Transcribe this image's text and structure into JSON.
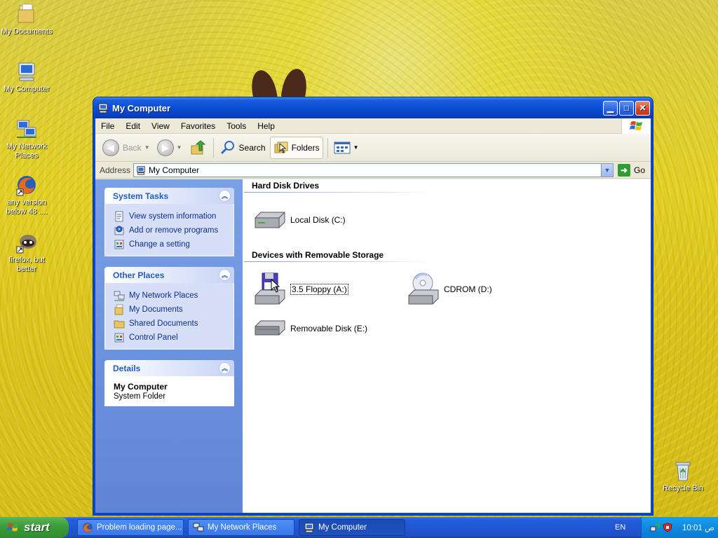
{
  "desktop": {
    "icons": [
      {
        "label": "My Documents"
      },
      {
        "label": "My Computer"
      },
      {
        "label": "My Network Places"
      },
      {
        "label": "any version below 48 ...."
      },
      {
        "label": "firefox, but better"
      },
      {
        "label": "Recycle Bin"
      }
    ]
  },
  "window": {
    "title": "My Computer",
    "menu": [
      "File",
      "Edit",
      "View",
      "Favorites",
      "Tools",
      "Help"
    ],
    "toolbar": {
      "back": "Back",
      "search": "Search",
      "folders": "Folders"
    },
    "address": {
      "label": "Address",
      "value": "My Computer",
      "go": "Go"
    },
    "taskpane": {
      "system_tasks": {
        "title": "System Tasks",
        "items": [
          "View system information",
          "Add or remove programs",
          "Change a setting"
        ]
      },
      "other_places": {
        "title": "Other Places",
        "items": [
          "My Network Places",
          "My Documents",
          "Shared Documents",
          "Control Panel"
        ]
      },
      "details": {
        "title": "Details",
        "name": "My Computer",
        "type": "System Folder"
      }
    },
    "groups": {
      "hard_disks": {
        "title": "Hard Disk Drives",
        "items": [
          "Local Disk (C:)"
        ]
      },
      "removable": {
        "title": "Devices with Removable Storage",
        "items": [
          "3.5 Floppy (A:)",
          "CDROM (D:)",
          "Removable Disk (E:)"
        ]
      }
    }
  },
  "taskbar": {
    "start": "start",
    "items": [
      "Problem loading page...",
      "My Network Places",
      "My Computer"
    ],
    "language": "EN",
    "clock": "10:01 ص"
  }
}
